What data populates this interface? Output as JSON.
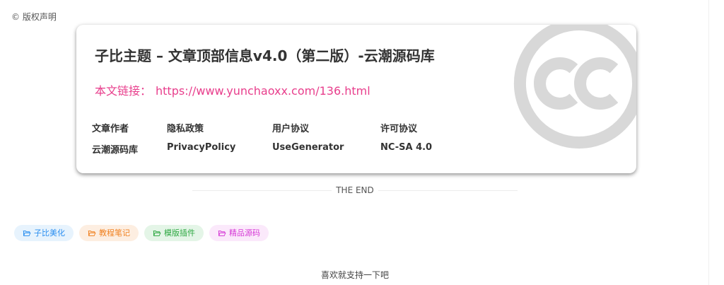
{
  "copyright": {
    "label": "© 版权声明"
  },
  "card": {
    "title": "子比主题 – 文章顶部信息v4.0（第二版）-云潮源码库",
    "link_label": "本文链接：",
    "link_url": "https://www.yunchaoxx.com/136.html",
    "logo_icon": "creative-commons-icon",
    "meta": [
      {
        "head": "文章作者",
        "value": "云潮源码库"
      },
      {
        "head": "隐私政策",
        "value": "PrivacyPolicy"
      },
      {
        "head": "用户协议",
        "value": "UseGenerator"
      },
      {
        "head": "许可协议",
        "value": "NC-SA 4.0"
      }
    ]
  },
  "divider": {
    "text": "THE END"
  },
  "tags": [
    {
      "label": "子比美化",
      "color": "#2b8ff0",
      "bg": "#e7f3fd",
      "icon": "folder-open-icon"
    },
    {
      "label": "教程笔记",
      "color": "#f0801f",
      "bg": "#fdeee1",
      "icon": "folder-open-icon"
    },
    {
      "label": "模版插件",
      "color": "#2ea842",
      "bg": "#e4f5e7",
      "icon": "folder-open-icon"
    },
    {
      "label": "精品源码",
      "color": "#d63ad6",
      "bg": "#fbe9fb",
      "icon": "folder-open-icon"
    }
  ],
  "footer": {
    "text": "喜欢就支持一下吧"
  }
}
